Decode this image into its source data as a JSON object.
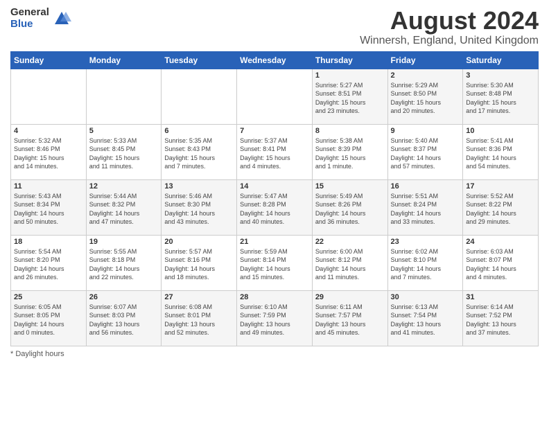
{
  "header": {
    "logo_general": "General",
    "logo_blue": "Blue",
    "title": "August 2024",
    "location": "Winnersh, England, United Kingdom"
  },
  "days_of_week": [
    "Sunday",
    "Monday",
    "Tuesday",
    "Wednesday",
    "Thursday",
    "Friday",
    "Saturday"
  ],
  "footer": {
    "note": "Daylight hours"
  },
  "weeks": [
    [
      {
        "num": "",
        "info": ""
      },
      {
        "num": "",
        "info": ""
      },
      {
        "num": "",
        "info": ""
      },
      {
        "num": "",
        "info": ""
      },
      {
        "num": "1",
        "info": "Sunrise: 5:27 AM\nSunset: 8:51 PM\nDaylight: 15 hours\nand 23 minutes."
      },
      {
        "num": "2",
        "info": "Sunrise: 5:29 AM\nSunset: 8:50 PM\nDaylight: 15 hours\nand 20 minutes."
      },
      {
        "num": "3",
        "info": "Sunrise: 5:30 AM\nSunset: 8:48 PM\nDaylight: 15 hours\nand 17 minutes."
      }
    ],
    [
      {
        "num": "4",
        "info": "Sunrise: 5:32 AM\nSunset: 8:46 PM\nDaylight: 15 hours\nand 14 minutes."
      },
      {
        "num": "5",
        "info": "Sunrise: 5:33 AM\nSunset: 8:45 PM\nDaylight: 15 hours\nand 11 minutes."
      },
      {
        "num": "6",
        "info": "Sunrise: 5:35 AM\nSunset: 8:43 PM\nDaylight: 15 hours\nand 7 minutes."
      },
      {
        "num": "7",
        "info": "Sunrise: 5:37 AM\nSunset: 8:41 PM\nDaylight: 15 hours\nand 4 minutes."
      },
      {
        "num": "8",
        "info": "Sunrise: 5:38 AM\nSunset: 8:39 PM\nDaylight: 15 hours\nand 1 minute."
      },
      {
        "num": "9",
        "info": "Sunrise: 5:40 AM\nSunset: 8:37 PM\nDaylight: 14 hours\nand 57 minutes."
      },
      {
        "num": "10",
        "info": "Sunrise: 5:41 AM\nSunset: 8:36 PM\nDaylight: 14 hours\nand 54 minutes."
      }
    ],
    [
      {
        "num": "11",
        "info": "Sunrise: 5:43 AM\nSunset: 8:34 PM\nDaylight: 14 hours\nand 50 minutes."
      },
      {
        "num": "12",
        "info": "Sunrise: 5:44 AM\nSunset: 8:32 PM\nDaylight: 14 hours\nand 47 minutes."
      },
      {
        "num": "13",
        "info": "Sunrise: 5:46 AM\nSunset: 8:30 PM\nDaylight: 14 hours\nand 43 minutes."
      },
      {
        "num": "14",
        "info": "Sunrise: 5:47 AM\nSunset: 8:28 PM\nDaylight: 14 hours\nand 40 minutes."
      },
      {
        "num": "15",
        "info": "Sunrise: 5:49 AM\nSunset: 8:26 PM\nDaylight: 14 hours\nand 36 minutes."
      },
      {
        "num": "16",
        "info": "Sunrise: 5:51 AM\nSunset: 8:24 PM\nDaylight: 14 hours\nand 33 minutes."
      },
      {
        "num": "17",
        "info": "Sunrise: 5:52 AM\nSunset: 8:22 PM\nDaylight: 14 hours\nand 29 minutes."
      }
    ],
    [
      {
        "num": "18",
        "info": "Sunrise: 5:54 AM\nSunset: 8:20 PM\nDaylight: 14 hours\nand 26 minutes."
      },
      {
        "num": "19",
        "info": "Sunrise: 5:55 AM\nSunset: 8:18 PM\nDaylight: 14 hours\nand 22 minutes."
      },
      {
        "num": "20",
        "info": "Sunrise: 5:57 AM\nSunset: 8:16 PM\nDaylight: 14 hours\nand 18 minutes."
      },
      {
        "num": "21",
        "info": "Sunrise: 5:59 AM\nSunset: 8:14 PM\nDaylight: 14 hours\nand 15 minutes."
      },
      {
        "num": "22",
        "info": "Sunrise: 6:00 AM\nSunset: 8:12 PM\nDaylight: 14 hours\nand 11 minutes."
      },
      {
        "num": "23",
        "info": "Sunrise: 6:02 AM\nSunset: 8:10 PM\nDaylight: 14 hours\nand 7 minutes."
      },
      {
        "num": "24",
        "info": "Sunrise: 6:03 AM\nSunset: 8:07 PM\nDaylight: 14 hours\nand 4 minutes."
      }
    ],
    [
      {
        "num": "25",
        "info": "Sunrise: 6:05 AM\nSunset: 8:05 PM\nDaylight: 14 hours\nand 0 minutes."
      },
      {
        "num": "26",
        "info": "Sunrise: 6:07 AM\nSunset: 8:03 PM\nDaylight: 13 hours\nand 56 minutes."
      },
      {
        "num": "27",
        "info": "Sunrise: 6:08 AM\nSunset: 8:01 PM\nDaylight: 13 hours\nand 52 minutes."
      },
      {
        "num": "28",
        "info": "Sunrise: 6:10 AM\nSunset: 7:59 PM\nDaylight: 13 hours\nand 49 minutes."
      },
      {
        "num": "29",
        "info": "Sunrise: 6:11 AM\nSunset: 7:57 PM\nDaylight: 13 hours\nand 45 minutes."
      },
      {
        "num": "30",
        "info": "Sunrise: 6:13 AM\nSunset: 7:54 PM\nDaylight: 13 hours\nand 41 minutes."
      },
      {
        "num": "31",
        "info": "Sunrise: 6:14 AM\nSunset: 7:52 PM\nDaylight: 13 hours\nand 37 minutes."
      }
    ]
  ]
}
